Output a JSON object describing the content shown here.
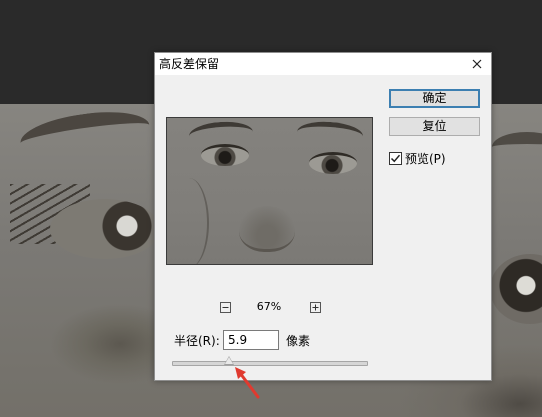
{
  "dialog": {
    "title": "高反差保留",
    "buttons": {
      "ok": "确定",
      "reset": "复位"
    },
    "preview_checkbox": {
      "label": "预览(P)",
      "checked": true
    },
    "zoom": {
      "level": "67%",
      "minus": "−",
      "plus": "+"
    },
    "radius": {
      "label": "半径(R):",
      "value": "5.9",
      "unit": "像素",
      "slider_fraction": 0.29
    }
  },
  "colors": {
    "accent_border": "#3c7fb1",
    "annotation_arrow": "#e03a2f"
  },
  "icons": {
    "close": "close-icon",
    "zoom_out": "zoom-out-icon",
    "zoom_in": "zoom-in-icon",
    "check": "checkmark-icon",
    "arrow": "arrow-up-right-icon"
  }
}
